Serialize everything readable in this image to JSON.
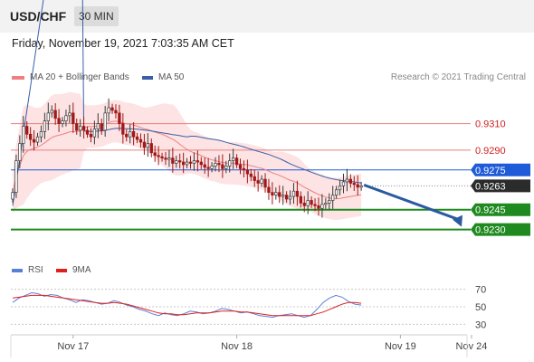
{
  "header": {
    "symbol": "USD/CHF",
    "timeframe": "30 MIN"
  },
  "datetime": "Friday, November 19, 2021 7:03:35 AM CET",
  "legend": {
    "ma20_bb": "MA 20 + Bollinger Bands",
    "ma50": "MA 50",
    "credit": "Research © 2021 Trading Central",
    "rsi": "RSI",
    "rsi_ma": "9MA"
  },
  "colors": {
    "ma20": "#f08080",
    "bollinger_fill": "#fde0e0",
    "ma50": "#3a5fa8",
    "resistance": "#e88080",
    "pivot": "#1e5bd8",
    "support": "#1f8a1f",
    "last_price": "#2b2b2b",
    "arrow": "#2a5aa0",
    "rsi": "#5a7fd6",
    "rsi_ma": "#e02020"
  },
  "chart_data": [
    {
      "type": "candlestick",
      "title": "",
      "ylim": [
        0.9212,
        0.9335
      ],
      "x_tick_labels": [
        {
          "label": "Nov 17",
          "bar": 17
        },
        {
          "label": "Nov 18",
          "bar": 63
        },
        {
          "label": "Nov 19",
          "bar": 109
        },
        {
          "label": "Nov 24",
          "bar": 129
        }
      ],
      "levels": [
        {
          "name": "resistance-2",
          "value": 0.931,
          "label": "0.9310",
          "kind": "resistance"
        },
        {
          "name": "resistance-1",
          "value": 0.929,
          "label": "0.9290",
          "kind": "resistance"
        },
        {
          "name": "pivot",
          "value": 0.9275,
          "label": "0.9275",
          "kind": "pivot"
        },
        {
          "name": "last-price",
          "value": 0.9263,
          "label": "0.9263",
          "kind": "last"
        },
        {
          "name": "support-1",
          "value": 0.9245,
          "label": "0.9245",
          "kind": "support"
        },
        {
          "name": "support-2",
          "value": 0.923,
          "label": "0.9230",
          "kind": "support"
        }
      ],
      "forecast_arrow": {
        "from": 0.9263,
        "to": 0.923
      },
      "close_path": [
        0.9258,
        0.9282,
        0.9295,
        0.9308,
        0.9302,
        0.9298,
        0.9296,
        0.93,
        0.9304,
        0.9312,
        0.9318,
        0.932,
        0.9314,
        0.931,
        0.9312,
        0.9316,
        0.9318,
        0.931,
        0.9305,
        0.9308,
        0.9305,
        0.9302,
        0.93,
        0.9306,
        0.931,
        0.9305,
        0.9318,
        0.9322,
        0.932,
        0.9318,
        0.931,
        0.9302,
        0.93,
        0.9304,
        0.93,
        0.9298,
        0.9296,
        0.9292,
        0.9295,
        0.9288,
        0.9286,
        0.9285,
        0.9284,
        0.9283,
        0.9284,
        0.928,
        0.9282,
        0.9281,
        0.9279,
        0.9281,
        0.928,
        0.9282,
        0.9281,
        0.9279,
        0.9277,
        0.9276,
        0.9278,
        0.928,
        0.9279,
        0.9276,
        0.9278,
        0.9282,
        0.9284,
        0.9279,
        0.9276,
        0.9275,
        0.9272,
        0.927,
        0.9267,
        0.9265,
        0.9268,
        0.9262,
        0.9258,
        0.9256,
        0.9258,
        0.9255,
        0.9256,
        0.9253,
        0.9255,
        0.9259,
        0.9255,
        0.925,
        0.9248,
        0.9252,
        0.9249,
        0.9248,
        0.9246,
        0.9249,
        0.925,
        0.9252,
        0.9256,
        0.926,
        0.9263,
        0.9266,
        0.9268,
        0.9265,
        0.9264,
        0.9262,
        0.9263
      ]
    },
    {
      "type": "line",
      "title": "RSI",
      "ylim": [
        20,
        80
      ],
      "y_ticks": [
        30,
        50,
        70
      ],
      "series": [
        {
          "name": "RSI",
          "values": [
            55,
            60,
            63,
            66,
            65,
            62,
            64,
            63,
            60,
            58,
            55,
            58,
            57,
            55,
            53,
            54,
            57,
            55,
            52,
            50,
            47,
            45,
            42,
            40,
            43,
            41,
            40,
            42,
            45,
            44,
            42,
            43,
            45,
            48,
            47,
            45,
            43,
            44,
            42,
            40,
            39,
            38,
            40,
            41,
            42,
            40,
            38,
            40,
            47,
            55,
            60,
            63,
            61,
            56,
            53,
            52
          ]
        },
        {
          "name": "9MA",
          "values": [
            60,
            61,
            62,
            63,
            63,
            63,
            62,
            61,
            60,
            59,
            58,
            57,
            56,
            55,
            54,
            54,
            55,
            54,
            53,
            51,
            49,
            47,
            45,
            43,
            42,
            42,
            41,
            41,
            42,
            43,
            43,
            43,
            44,
            45,
            45,
            45,
            44,
            44,
            43,
            42,
            41,
            40,
            40,
            40,
            40,
            40,
            40,
            40,
            42,
            44,
            47,
            50,
            53,
            55,
            55,
            54
          ]
        }
      ]
    }
  ]
}
